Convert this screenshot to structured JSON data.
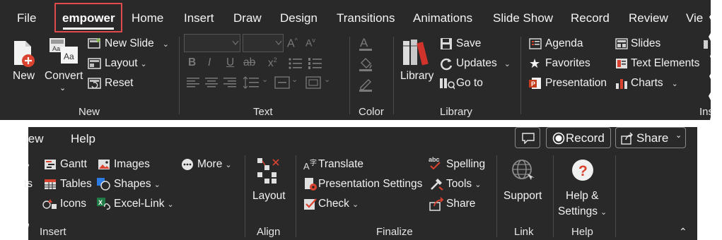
{
  "tabs": [
    "File",
    "empower",
    "Home",
    "Insert",
    "Draw",
    "Design",
    "Transitions",
    "Animations",
    "Slide Show",
    "Record",
    "Review",
    "Vie"
  ],
  "new_group": {
    "new": "New",
    "convert": "Convert",
    "new_slide": "New Slide",
    "layout": "Layout",
    "reset": "Reset",
    "group": "New"
  },
  "text_group": {
    "group": "Text"
  },
  "color_group": {
    "group": "Color"
  },
  "library_group": {
    "library": "Library",
    "save": "Save",
    "updates": "Updates",
    "go_to": "Go to",
    "group": "Library"
  },
  "insert_top": {
    "agenda": "Agenda",
    "favorites": "Favorites",
    "presentation": "Presentation",
    "slides": "Slides",
    "text_elements": "Text Elements",
    "charts": "Charts",
    "group_partial": "Ins"
  },
  "bottom_tabs": {
    "view_partial": "iew",
    "help": "Help"
  },
  "actions": {
    "record": "Record",
    "share": "Share"
  },
  "insert_bottom": {
    "gantt": "Gantt",
    "tables": "Tables",
    "icons": "Icons",
    "images": "Images",
    "shapes": "Shapes",
    "excel_link": "Excel-Link",
    "more": "More",
    "partial_ts": "ts",
    "group": "Insert"
  },
  "align_group": {
    "layout": "Layout",
    "group": "Align"
  },
  "finalize_group": {
    "translate": "Translate",
    "presentation_settings": "Presentation Settings",
    "check": "Check",
    "spelling": "Spelling",
    "tools": "Tools",
    "share": "Share",
    "group": "Finalize"
  },
  "link_group": {
    "support": "Support",
    "group": "Link"
  },
  "help_group": {
    "help_line1": "Help &",
    "help_line2": "Settings",
    "group": "Help"
  },
  "colors": {
    "ribbon": "#292929",
    "accent_red": "#e14b4b",
    "record_dot": "#ffffff"
  }
}
